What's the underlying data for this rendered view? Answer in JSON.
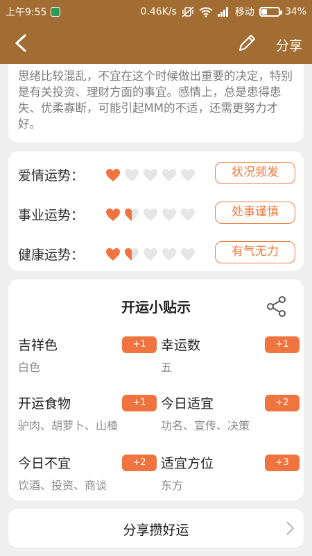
{
  "status_bar": {
    "time": "上午9:55",
    "speed": "0.46K/s",
    "carrier": "移动",
    "battery": "34%",
    "battery_level": 0.34
  },
  "nav": {
    "share_label": "分享",
    "back_icon": "chevron-left-icon",
    "edit_icon": "pencil-icon"
  },
  "intro_text": "思绪比较混乱，不宜在这个时候做出重要的决定，特别是有关投资、理财方面的事宜。感情上，总是患得患失、优柔寡断，可能引起MM的不适，还需更努力才好。",
  "fortunes": [
    {
      "label": "爱情运势：",
      "rating": 1.0,
      "max": 5,
      "status": "状况频发"
    },
    {
      "label": "事业运势：",
      "rating": 1.5,
      "max": 5,
      "status": "处事谨慎"
    },
    {
      "label": "健康运势：",
      "rating": 1.5,
      "max": 5,
      "status": "有气无力"
    }
  ],
  "tips": {
    "title": "开运小贴示",
    "items": [
      {
        "name": "吉祥色",
        "value": "白色",
        "badge": "+1"
      },
      {
        "name": "幸运数",
        "value": "五",
        "badge": "+1"
      },
      {
        "name": "开运食物",
        "value": "驴肉、胡萝卜、山楂",
        "badge": "+1"
      },
      {
        "name": "今日适宜",
        "value": "功名、宣传、决策",
        "badge": "+2"
      },
      {
        "name": "今日不宜",
        "value": "饮酒、投资、商谈",
        "badge": "+2"
      },
      {
        "name": "适宜方位",
        "value": "东方",
        "badge": "+3"
      }
    ]
  },
  "bottom_button": {
    "label": "分享攒好运"
  },
  "colors": {
    "header": "#a26d33",
    "accent": "#ef7440",
    "heart_on": "#ef7440",
    "heart_off": "#e6e6e6"
  }
}
